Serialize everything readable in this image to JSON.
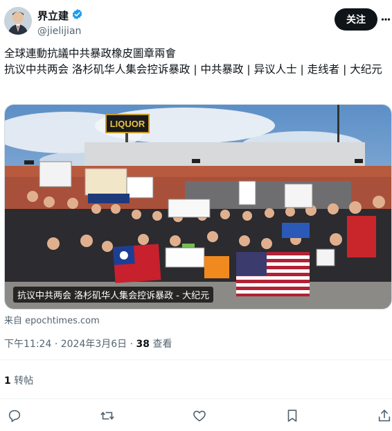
{
  "author": {
    "display_name": "界立建",
    "handle": "@jielijian",
    "verified_icon": "verified-badge-icon",
    "verified_color": "#1d9bf0"
  },
  "header": {
    "follow_label": "关注",
    "more_icon": "more-dots-icon"
  },
  "post": {
    "line1": "全球連動抗議中共暴政橡皮圖章兩會",
    "line2": "抗议中共两会 洛杉矶华人集会控诉暴政 | 中共暴政 | 异议人士 | 走线者 | 大纪元"
  },
  "media": {
    "caption": "抗议中共两会 洛杉矶华人集会控诉暴政 - 大纪元",
    "sign_store": "LIQUOR"
  },
  "source": "来自 epochtimes.com",
  "meta": {
    "time": "下午11:24",
    "separator": "·",
    "date": "2024年3月6日",
    "views": "38",
    "views_label": "查看"
  },
  "stats": {
    "reposts": "1",
    "reposts_label": "转帖"
  },
  "actions": {
    "reply_icon": "reply-icon",
    "repost_icon": "repost-icon",
    "like_icon": "like-icon",
    "bookmark_icon": "bookmark-icon",
    "share_icon": "share-icon"
  },
  "colors": {
    "text": "#0f1419",
    "secondary": "#536471",
    "button_bg": "#0f1419"
  }
}
